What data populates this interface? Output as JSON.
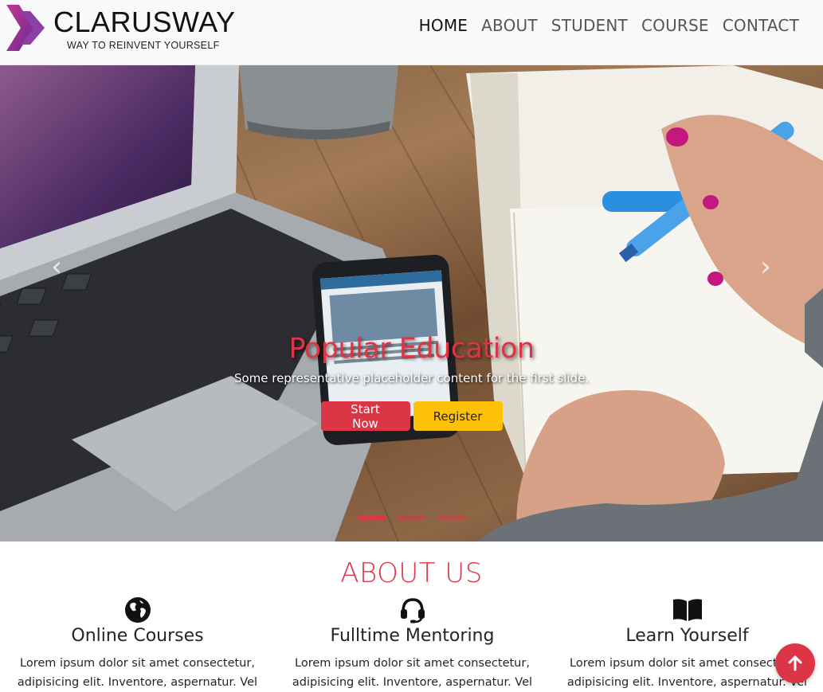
{
  "brand": {
    "name": "CLARUSWAY",
    "tagline": "WAY TO REINVENT YOURSELF"
  },
  "nav": {
    "items": [
      "HOME",
      "ABOUT",
      "STUDENT",
      "COURSE",
      "CONTACT"
    ],
    "active": "HOME"
  },
  "carousel": {
    "title": "Popular Education",
    "text": "Some representative placeholder content for the first slide.",
    "primary_button": "Start Now",
    "secondary_button": "Register",
    "prev_icon": "‹",
    "next_icon": "›",
    "slide_count": 3,
    "active_slide": 1
  },
  "about": {
    "title": "ABOUT US",
    "features": [
      {
        "icon": "globe-icon",
        "title": "Online Courses",
        "text": "Lorem ipsum dolor sit amet consectetur, adipisicing elit. Inventore, aspernatur. Vel"
      },
      {
        "icon": "headset-icon",
        "title": "Fulltime Mentoring",
        "text": "Lorem ipsum dolor sit amet consectetur, adipisicing elit. Inventore, aspernatur. Vel"
      },
      {
        "icon": "book-icon",
        "title": "Learn Yourself",
        "text": "Lorem ipsum dolor sit amet consectetur, adipisicing elit. Inventore, aspernatur. Vel"
      }
    ]
  },
  "colors": {
    "accent": "#dc3545",
    "warning": "#ffc107",
    "navbar": "#f8f9fa"
  },
  "scroll_top_icon": "arrow-up-icon"
}
